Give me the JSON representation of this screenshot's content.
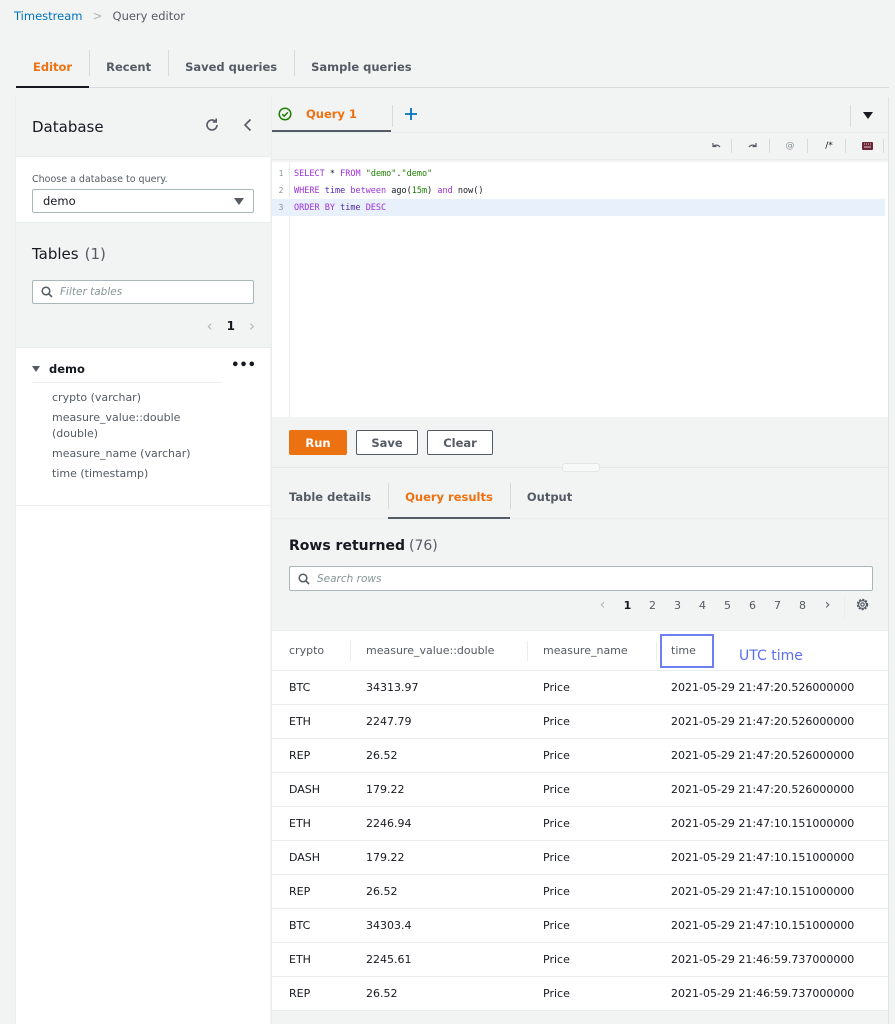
{
  "breadcrumb": {
    "service": "Timestream",
    "current": "Query editor"
  },
  "top_tabs": [
    {
      "label": "Editor",
      "active": true
    },
    {
      "label": "Recent",
      "active": false
    },
    {
      "label": "Saved queries",
      "active": false
    },
    {
      "label": "Sample queries",
      "active": false
    }
  ],
  "database_panel": {
    "title": "Database",
    "choose_label": "Choose a database to query.",
    "selected_database": "demo",
    "tables_title": "Tables",
    "tables_count": "(1)",
    "filter_placeholder": "Filter tables",
    "current_page": "1",
    "table": {
      "name": "demo",
      "columns": [
        "crypto (varchar)",
        "measure_value::double (double)",
        "measure_name (varchar)",
        "time (timestamp)"
      ]
    }
  },
  "editor": {
    "query_tab_label": "Query 1",
    "query_status": "success",
    "toolbar": [
      "undo-icon",
      "redo-icon",
      "at-icon",
      "comment-icon",
      "keyboard-icon"
    ],
    "code_lines": [
      {
        "n": "1",
        "text": "SELECT * FROM \"demo\".\"demo\""
      },
      {
        "n": "2",
        "text": "WHERE time between ago(15m) and now()"
      },
      {
        "n": "3",
        "text": "ORDER BY time DESC"
      }
    ],
    "run_label": "Run",
    "save_label": "Save",
    "clear_label": "Clear"
  },
  "results": {
    "tabs": [
      {
        "label": "Table details",
        "active": false
      },
      {
        "label": "Query results",
        "active": true
      },
      {
        "label": "Output",
        "active": false
      }
    ],
    "rows_title": "Rows returned",
    "rows_count": "(76)",
    "search_placeholder": "Search rows",
    "pages": [
      "1",
      "2",
      "3",
      "4",
      "5",
      "6",
      "7",
      "8"
    ],
    "current_page": "1",
    "columns": [
      "crypto",
      "measure_value::double",
      "measure_name",
      "time"
    ],
    "annotation": "UTC time",
    "rows": [
      [
        "BTC",
        "34313.97",
        "Price",
        "2021-05-29 21:47:20.526000000"
      ],
      [
        "ETH",
        "2247.79",
        "Price",
        "2021-05-29 21:47:20.526000000"
      ],
      [
        "REP",
        "26.52",
        "Price",
        "2021-05-29 21:47:20.526000000"
      ],
      [
        "DASH",
        "179.22",
        "Price",
        "2021-05-29 21:47:20.526000000"
      ],
      [
        "ETH",
        "2246.94",
        "Price",
        "2021-05-29 21:47:10.151000000"
      ],
      [
        "DASH",
        "179.22",
        "Price",
        "2021-05-29 21:47:10.151000000"
      ],
      [
        "REP",
        "26.52",
        "Price",
        "2021-05-29 21:47:10.151000000"
      ],
      [
        "BTC",
        "34303.4",
        "Price",
        "2021-05-29 21:47:10.151000000"
      ],
      [
        "ETH",
        "2245.61",
        "Price",
        "2021-05-29 21:46:59.737000000"
      ],
      [
        "REP",
        "26.52",
        "Price",
        "2021-05-29 21:46:59.737000000"
      ]
    ]
  },
  "colors": {
    "accent": "#ec7211",
    "link": "#0073bb",
    "annotation": "#5a6ff0"
  }
}
